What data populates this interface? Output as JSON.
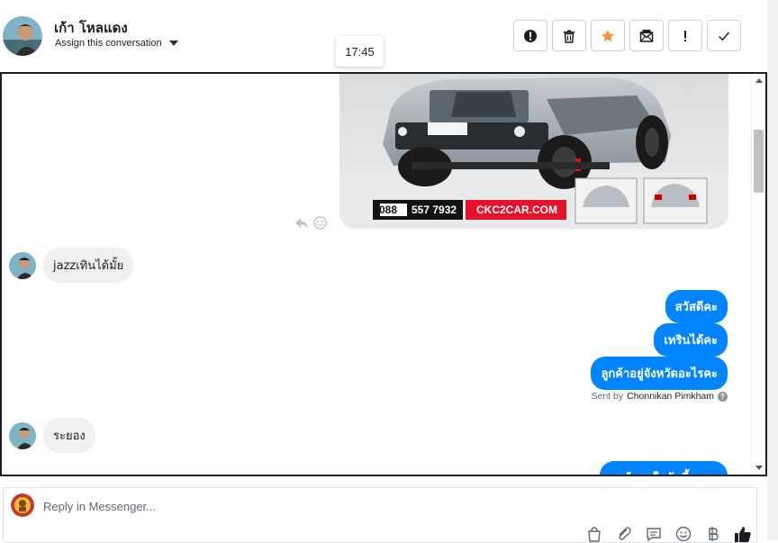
{
  "header": {
    "contact_name": "เก้า โหลแดง",
    "assign_label": "Assign this conversation",
    "tooltip_time": "17:45",
    "actions": [
      {
        "name": "report-spam-button",
        "icon": "exclamation-circle-icon"
      },
      {
        "name": "delete-button",
        "icon": "trash-icon"
      },
      {
        "name": "star-button",
        "icon": "star-icon",
        "color": "#f7923b"
      },
      {
        "name": "mark-unread-button",
        "icon": "envelope-icon"
      },
      {
        "name": "follow-up-button",
        "icon": "exclamation-icon"
      },
      {
        "name": "mark-done-button",
        "icon": "checkmark-icon"
      }
    ]
  },
  "conversation": {
    "car_ad": {
      "phone_a": "088",
      "phone_b": "557 7932",
      "brand": "CKC2CAR.COM"
    },
    "messages": [
      {
        "direction": "in",
        "text": "jazzเทินได้มั้ย"
      },
      {
        "direction": "out",
        "text": "สวัสดีคะ"
      },
      {
        "direction": "out",
        "text": "เทรินได้คะ"
      },
      {
        "direction": "out",
        "text": "ลูกค้าอยู่จังหวัดอะไรคะ"
      },
      {
        "direction": "in",
        "text": "ระยอง"
      },
      {
        "direction": "out",
        "text": "ลูกค้าสนใจคันนี้มะคะ"
      }
    ],
    "sent_by_prefix": "Sent by",
    "sent_by_name": "Chonnikan Pimkham"
  },
  "composer": {
    "placeholder": "Reply in Messenger...",
    "tools": [
      "shopping-bag-icon",
      "paperclip-icon",
      "saved-reply-icon",
      "emoji-icon",
      "baht-icon",
      "thumbs-up-icon"
    ]
  },
  "colors": {
    "outgoing_bubble": "#0084ff",
    "incoming_bubble": "#f0f0f0",
    "star": "#f7923b",
    "ad_red": "#e6112b"
  }
}
